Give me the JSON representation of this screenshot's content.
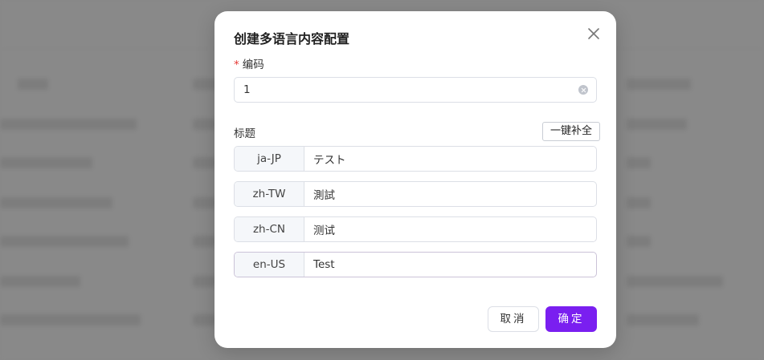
{
  "dialog": {
    "title": "创建多语言内容配置",
    "close_icon": "close-icon",
    "code_required_mark": "*",
    "code_label": "编码",
    "code_value": "1",
    "title_label": "标题",
    "fill_all_label": "一键补全",
    "languages": [
      {
        "code": "ja-JP",
        "value": "テスト"
      },
      {
        "code": "zh-TW",
        "value": "測試"
      },
      {
        "code": "zh-CN",
        "value": "测试"
      },
      {
        "code": "en-US",
        "value": "Test"
      }
    ],
    "cancel_label": "取消",
    "confirm_label": "确定"
  },
  "colors": {
    "primary": "#7a1ff0",
    "required": "#e53935",
    "overlay": "#8b8b8b"
  }
}
